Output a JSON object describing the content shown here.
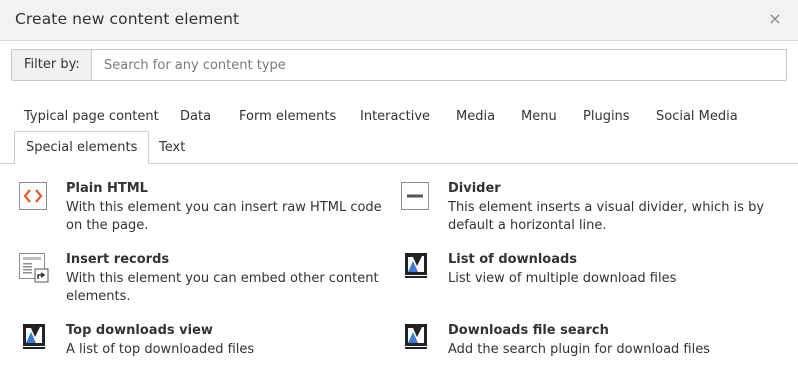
{
  "header": {
    "title": "Create new content element",
    "close_glyph": "×"
  },
  "filter": {
    "label": "Filter by:",
    "placeholder": "Search for any content type",
    "value": ""
  },
  "tabs": [
    {
      "label": "Typical page content"
    },
    {
      "label": "Data"
    },
    {
      "label": "Form elements"
    },
    {
      "label": "Interactive"
    },
    {
      "label": "Media"
    },
    {
      "label": "Menu"
    },
    {
      "label": "Plugins"
    },
    {
      "label": "Social Media"
    },
    {
      "label": "Special elements",
      "active": true
    },
    {
      "label": "Text"
    }
  ],
  "elements": [
    {
      "icon": "html-code-icon",
      "title": "Plain HTML",
      "description": "With this element you can insert raw HTML code on the page."
    },
    {
      "icon": "divider-icon",
      "title": "Divider",
      "description": "This element inserts a visual divider, which is by default a horizontal line."
    },
    {
      "icon": "insert-records-icon",
      "title": "Insert records",
      "description": "With this element you can embed other content elements."
    },
    {
      "icon": "downloads-extension-icon",
      "title": "List of downloads",
      "description": "List view of multiple download files"
    },
    {
      "icon": "downloads-extension-icon",
      "title": "Top downloads view",
      "description": "A list of top downloaded files"
    },
    {
      "icon": "downloads-extension-icon",
      "title": "Downloads file search",
      "description": "Add the search plugin for download files"
    }
  ],
  "colors": {
    "header_bg": "#f2f2f2",
    "html_icon_accent": "#e8562a",
    "divider_icon": "#555555"
  }
}
